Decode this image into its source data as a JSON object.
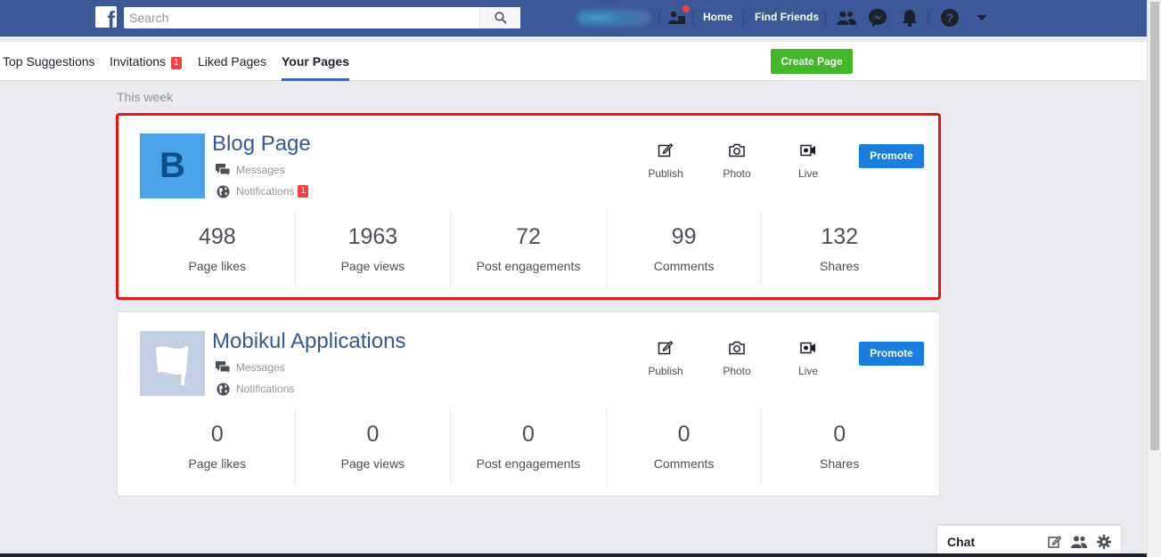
{
  "topbar": {
    "search_placeholder": "Search",
    "home_label": "Home",
    "find_friends_label": "Find Friends"
  },
  "tabs": {
    "top_suggestions": "Top Suggestions",
    "invitations": "Invitations",
    "invitations_count": "1",
    "liked_pages": "Liked Pages",
    "your_pages": "Your Pages",
    "create_page": "Create Page"
  },
  "week_label": "This week",
  "pages": [
    {
      "name": "Blog Page",
      "thumb_letter": "B",
      "messages_label": "Messages",
      "notifications_label": "Notifications",
      "notifications_count": "1",
      "actions": {
        "publish": "Publish",
        "photo": "Photo",
        "live": "Live"
      },
      "promote_label": "Promote",
      "stats": [
        {
          "value": "498",
          "label": "Page likes"
        },
        {
          "value": "1963",
          "label": "Page views"
        },
        {
          "value": "72",
          "label": "Post engagements"
        },
        {
          "value": "99",
          "label": "Comments"
        },
        {
          "value": "132",
          "label": "Shares"
        }
      ]
    },
    {
      "name": "Mobikul Applications",
      "messages_label": "Messages",
      "notifications_label": "Notifications",
      "actions": {
        "publish": "Publish",
        "photo": "Photo",
        "live": "Live"
      },
      "promote_label": "Promote",
      "stats": [
        {
          "value": "0",
          "label": "Page likes"
        },
        {
          "value": "0",
          "label": "Page views"
        },
        {
          "value": "0",
          "label": "Post engagements"
        },
        {
          "value": "0",
          "label": "Comments"
        },
        {
          "value": "0",
          "label": "Shares"
        }
      ]
    }
  ],
  "chat": {
    "title": "Chat"
  },
  "colors": {
    "brand": "#3b5998",
    "create_button": "#42b72a",
    "promote_button": "#1a7ee0",
    "badge": "#fa3e3e",
    "highlight": "#e8141c"
  }
}
